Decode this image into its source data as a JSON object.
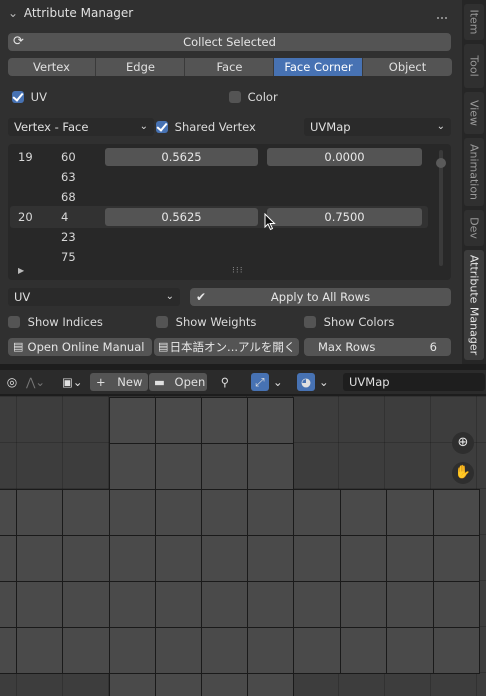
{
  "panel": {
    "title": "Attribute Manager",
    "collect_label": "Collect Selected",
    "domains": [
      {
        "label": "Vertex",
        "active": false
      },
      {
        "label": "Edge",
        "active": false
      },
      {
        "label": "Face",
        "active": false
      },
      {
        "label": "Face Corner",
        "active": true
      },
      {
        "label": "Object",
        "active": false
      }
    ],
    "uv_label": "UV",
    "uv_checked": true,
    "color_label": "Color",
    "color_checked": false,
    "mode_value": "Vertex - Face",
    "shared_vertex_label": "Shared Vertex",
    "shared_vertex_checked": true,
    "uvmap_value": "UVMap",
    "rows": [
      {
        "index": "19",
        "sub": "60",
        "u": "0.5625",
        "v": "0.0000"
      },
      {
        "index": "",
        "sub": "63",
        "u": "",
        "v": ""
      },
      {
        "index": "",
        "sub": "68",
        "u": "",
        "v": ""
      },
      {
        "index": "20",
        "sub": "4",
        "u": "0.5625",
        "v": "0.7500"
      },
      {
        "index": "",
        "sub": "23",
        "u": "",
        "v": ""
      },
      {
        "index": "",
        "sub": "75",
        "u": "",
        "v": ""
      }
    ],
    "target_value": "UV",
    "apply_label": "Apply to All Rows",
    "show_indices_label": "Show Indices",
    "show_weights_label": "Show Weights",
    "show_colors_label": "Show Colors",
    "manual_label": "Open Online Manual",
    "manual_jp_label": "日本語オン...アルを開く",
    "max_rows_label": "Max Rows",
    "max_rows_value": "6"
  },
  "side_tabs": [
    "Item",
    "Tool",
    "View",
    "Animation",
    "Dev",
    "Attribute Manager"
  ],
  "side_tab_active": "Attribute Manager",
  "uv_toolbar": {
    "new_label": "New",
    "open_label": "Open",
    "uvmap_name": "UVMap"
  },
  "icons": [
    "refresh-icon",
    "chevron-down-icon",
    "checkbox-icon",
    "zoom-icon",
    "hand-icon",
    "pin-icon",
    "image-icon",
    "folder-icon",
    "overlay-icon",
    "sync-icon"
  ],
  "colors": {
    "accent": "#4772b3",
    "panel": "#303030",
    "widget": "#545454"
  }
}
